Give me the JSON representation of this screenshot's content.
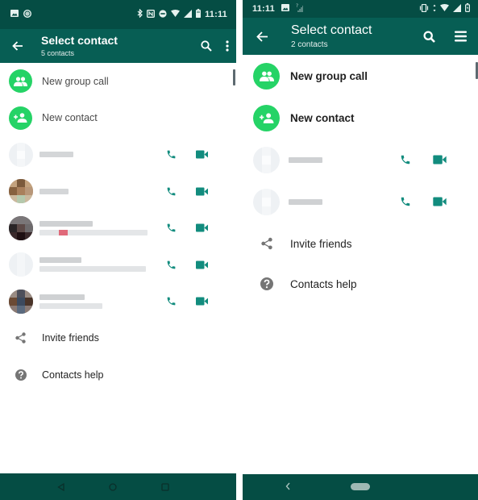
{
  "colors": {
    "status_bar": "#054d44",
    "app_bar": "#075e54",
    "accent_green": "#25d366",
    "call_icon_teal": "#128c7e",
    "nav_bar": "#054d44"
  },
  "left_phone": {
    "status_bar": {
      "icons_left": [
        "image-icon",
        "circle-icon"
      ],
      "icons_right": [
        "bluetooth-icon",
        "nfc-icon",
        "do-not-disturb-icon",
        "wifi-icon",
        "signal-icon",
        "battery-icon"
      ],
      "time": "11:11"
    },
    "app_bar": {
      "title": "Select contact",
      "subtitle": "5 contacts",
      "actions": [
        "search-icon",
        "more-vertical-icon"
      ]
    },
    "actions": [
      {
        "label": "New group call",
        "icon": "group-icon"
      },
      {
        "label": "New contact",
        "icon": "person-add-icon"
      }
    ],
    "contacts_count": 5,
    "footer_items": [
      {
        "label": "Invite friends",
        "icon": "share-icon"
      },
      {
        "label": "Contacts help",
        "icon": "help-icon"
      }
    ],
    "nav_bar": [
      "back-icon",
      "home-icon",
      "recents-icon"
    ]
  },
  "right_phone": {
    "status_bar": {
      "time": "11:11",
      "icons_left": [
        "image-icon",
        "signal-unknown-icon"
      ],
      "icons_right": [
        "vibrate-icon",
        "data-icon",
        "wifi-icon",
        "signal-icon",
        "battery-charging-icon"
      ]
    },
    "app_bar": {
      "title": "Select contact",
      "subtitle": "2 contacts",
      "actions": [
        "search-icon",
        "menu-icon"
      ]
    },
    "actions": [
      {
        "label": "New group call",
        "icon": "group-icon"
      },
      {
        "label": "New contact",
        "icon": "person-add-icon"
      }
    ],
    "contacts_count": 2,
    "footer_items": [
      {
        "label": "Invite friends",
        "icon": "share-icon"
      },
      {
        "label": "Contacts help",
        "icon": "help-icon"
      }
    ],
    "nav_bar": [
      "back-chevron-icon",
      "home-pill-icon"
    ]
  }
}
